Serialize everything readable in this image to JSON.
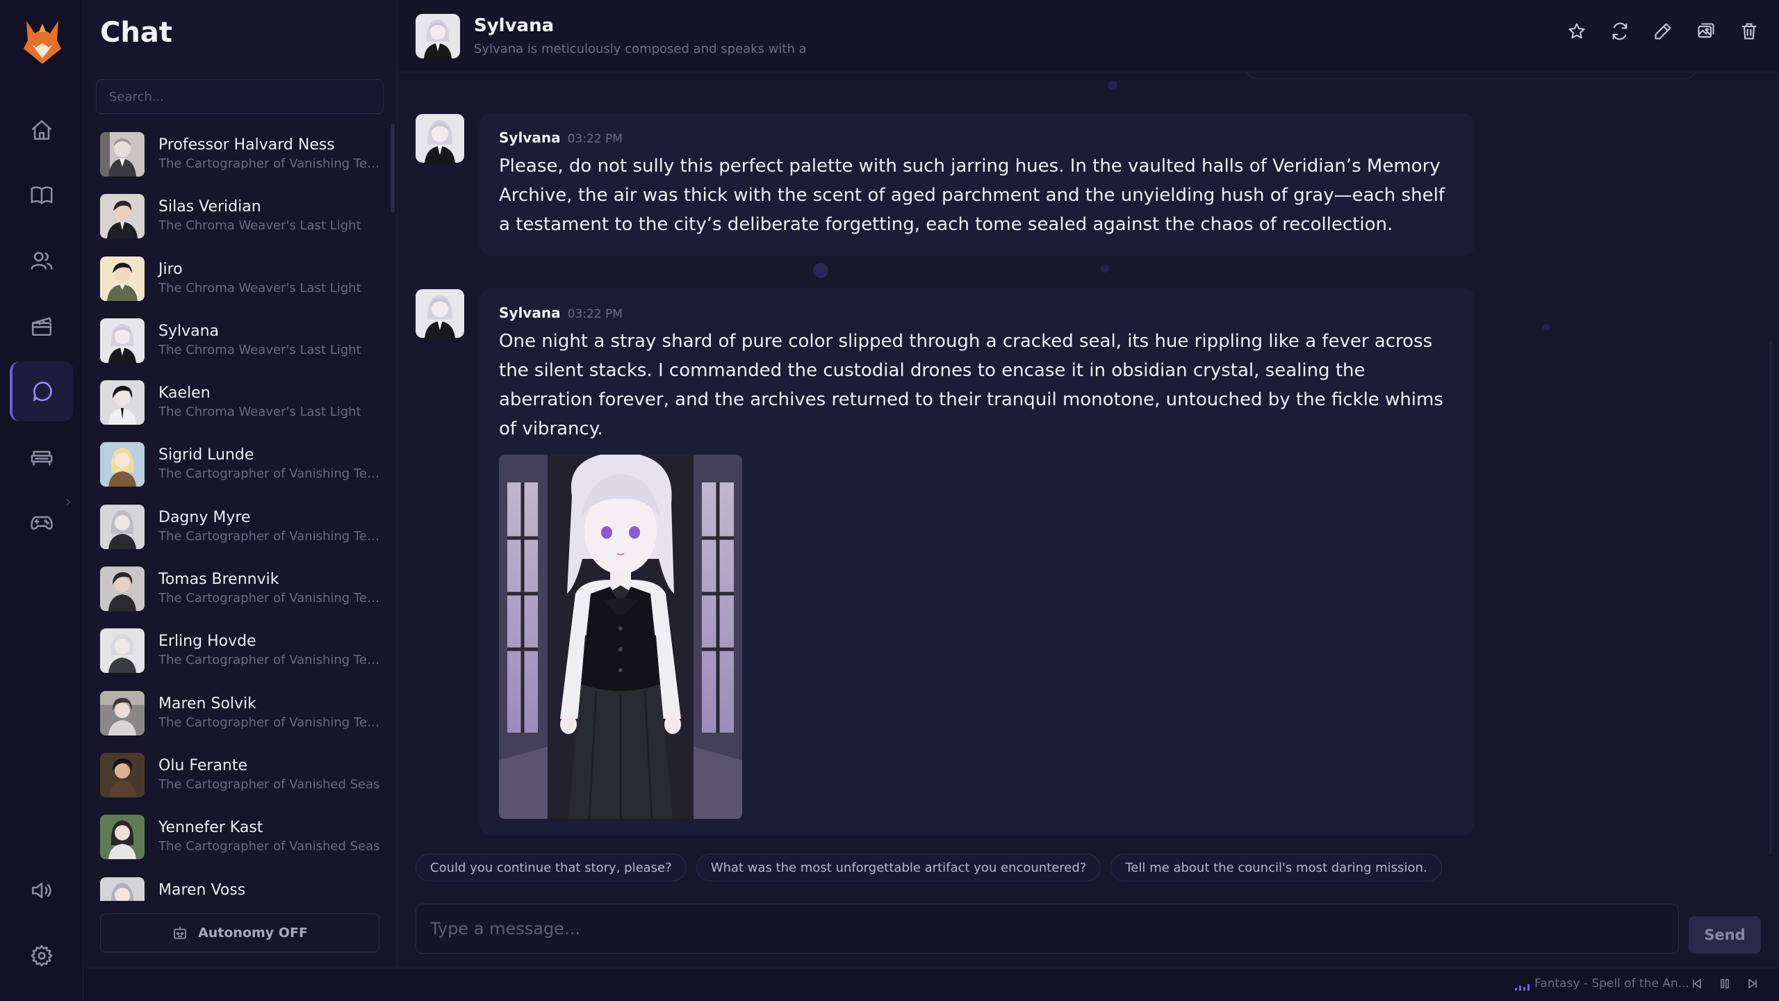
{
  "app": {
    "title": "Chat",
    "accent_color": "#6f5be0"
  },
  "rail": {
    "items": [
      {
        "icon": "home-icon"
      },
      {
        "icon": "book-icon"
      },
      {
        "icon": "users-icon"
      },
      {
        "icon": "clapperboard-icon"
      },
      {
        "icon": "chat-bubble-icon",
        "active": true
      },
      {
        "icon": "sofa-icon"
      },
      {
        "icon": "gamepad-icon"
      },
      {
        "icon": "speaker-icon"
      },
      {
        "icon": "gear-icon"
      }
    ]
  },
  "sidebar": {
    "search_placeholder": "Search...",
    "chats": [
      {
        "name": "Professor Halvard Ness",
        "subtitle": "The Cartographer of Vanishing Territories"
      },
      {
        "name": "Silas Veridian",
        "subtitle": "The Chroma Weaver's Last Light"
      },
      {
        "name": "Jiro",
        "subtitle": "The Chroma Weaver's Last Light"
      },
      {
        "name": "Sylvana",
        "subtitle": "The Chroma Weaver's Last Light"
      },
      {
        "name": "Kaelen",
        "subtitle": "The Chroma Weaver's Last Light"
      },
      {
        "name": "Sigrid Lunde",
        "subtitle": "The Cartographer of Vanishing Territories"
      },
      {
        "name": "Dagny Myre",
        "subtitle": "The Cartographer of Vanishing Territories"
      },
      {
        "name": "Tomas Brennvik",
        "subtitle": "The Cartographer of Vanishing Territories"
      },
      {
        "name": "Erling Hovde",
        "subtitle": "The Cartographer of Vanishing Territories"
      },
      {
        "name": "Maren Solvik",
        "subtitle": "The Cartographer of Vanishing Territories"
      },
      {
        "name": "Olu Ferante",
        "subtitle": "The Cartographer of Vanished Seas"
      },
      {
        "name": "Yennefer Kast",
        "subtitle": "The Cartographer of Vanished Seas"
      },
      {
        "name": "Maren Voss",
        "subtitle": ""
      }
    ],
    "autonomy_label": "Autonomy OFF"
  },
  "header": {
    "name": "Sylvana",
    "description": "Sylvana is meticulously composed and speaks with a"
  },
  "messages": [
    {
      "author": "Sylvana",
      "time": "03:22 PM",
      "text": "Please, do not sully this perfect palette with such jarring hues. In the vaulted halls of Veridian’s Memory Archive, the air was thick with the scent of aged parchment and the unyielding hush of gray—each shelf a testament to the city’s deliberate forgetting, each tome sealed against the chaos of recollection."
    },
    {
      "author": "Sylvana",
      "time": "03:22 PM",
      "text": "One night a stray shard of pure color slipped through a cracked seal, its hue rippling like a fever across the silent stacks. I commanded the custodial drones to encase it in obsidian crystal, sealing the aberration forever, and the archives returned to their tranquil monotone, untouched by the fickle whims of vibrancy."
    }
  ],
  "suggestions": [
    "Could you continue that story, please?",
    "What was the most unforgettable artifact you encountered?",
    "Tell me about the council's most daring mission."
  ],
  "composer": {
    "placeholder": "Type a message...",
    "send_label": "Send"
  },
  "music": {
    "track": "Fantasy - Spell of the An..."
  }
}
